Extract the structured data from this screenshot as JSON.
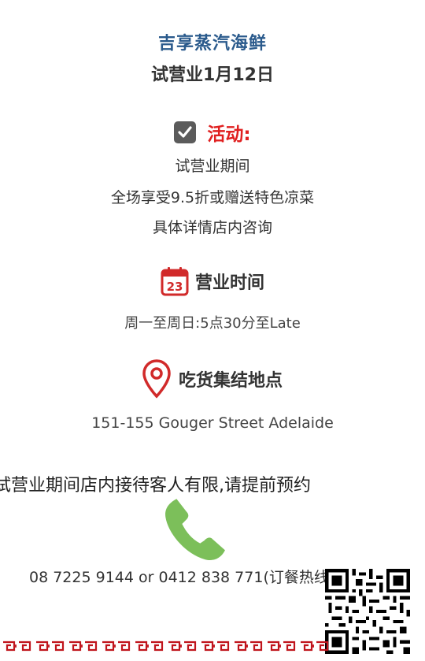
{
  "header": {
    "title": "吉享蒸汽海鲜",
    "subtitle": "试营业1月12日"
  },
  "activity": {
    "icon": "checkbox-checked-icon",
    "label": "活动:",
    "label_color": "#e02020",
    "lines": [
      "试营业期间",
      "全场享受9.5折或赠送特色凉菜",
      "具体详情店内咨询"
    ]
  },
  "hours": {
    "icon": "calendar-icon",
    "calendar_day": "23",
    "label": "营业时间",
    "text": "周一至周日:5点30分至Late"
  },
  "location": {
    "icon": "map-pin-icon",
    "label": "吃货集结地点",
    "address": "151-155 Gouger Street Adelaide"
  },
  "notice": "试营业期间店内接待客人有限,请提前预约",
  "contact": {
    "icon": "phone-icon",
    "phone_text": "08 7225 9144 or 0412 838 771(订餐热线)",
    "phone_icon_color": "#7cbf5a"
  },
  "qr_code": {
    "icon": "qr-code-icon"
  },
  "decor": {
    "border_color": "#c0141c"
  }
}
